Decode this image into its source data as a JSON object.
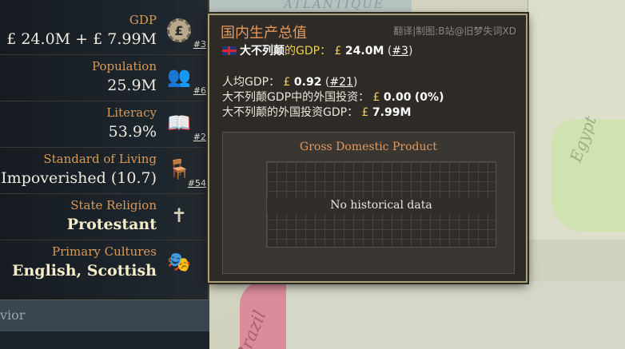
{
  "map": {
    "sea_label": "ATLANTIQUE",
    "region_east": "Egypt",
    "region_south": "Brazil"
  },
  "panel": {
    "rows": [
      {
        "label": "GDP",
        "value": "£ 24.0M + £ 7.99M",
        "rank": "#3",
        "icon": "coin-gear-icon"
      },
      {
        "label": "Population",
        "value": "25.9M",
        "rank": "#6",
        "icon": "people-icon"
      },
      {
        "label": "Literacy",
        "value": "53.9%",
        "rank": "#2",
        "icon": "book-icon"
      },
      {
        "label": "Standard of Living",
        "value": "Impoverished (10.7)",
        "rank": "#54",
        "icon": "chair-icon"
      },
      {
        "label": "State Religion",
        "value": "Protestant",
        "rank": "",
        "icon": "cross-icon"
      },
      {
        "label": "Primary Cultures",
        "value": "English, Scottish",
        "rank": "",
        "icon": "masks-icon"
      }
    ],
    "bottom_label": "vior"
  },
  "tooltip": {
    "title": "国内生产总值",
    "credit": "翻译|制图:B站@旧梦失词XD",
    "country_line": {
      "country": "大不列颠",
      "suffix": "的GDP：",
      "currency": "£",
      "value": "24.0M",
      "rank": "#3"
    },
    "per_capita": {
      "label": "人均GDP：",
      "currency": "£",
      "value": "0.92",
      "rank": "#21"
    },
    "foreign_share": {
      "label": "大不列颠GDP中的外国投资：",
      "currency": "£",
      "value": "0.00",
      "pct": "(0%)"
    },
    "foreign_gdp": {
      "label": "大不列颠的外国投资GDP：",
      "currency": "£",
      "value": "7.99M"
    },
    "chart": {
      "title": "Gross Domestic Product",
      "empty_message": "No historical data"
    }
  },
  "colors": {
    "accent_orange": "#e49a5e",
    "gold": "#f0d24a",
    "panel_bg": "#1d252c"
  }
}
